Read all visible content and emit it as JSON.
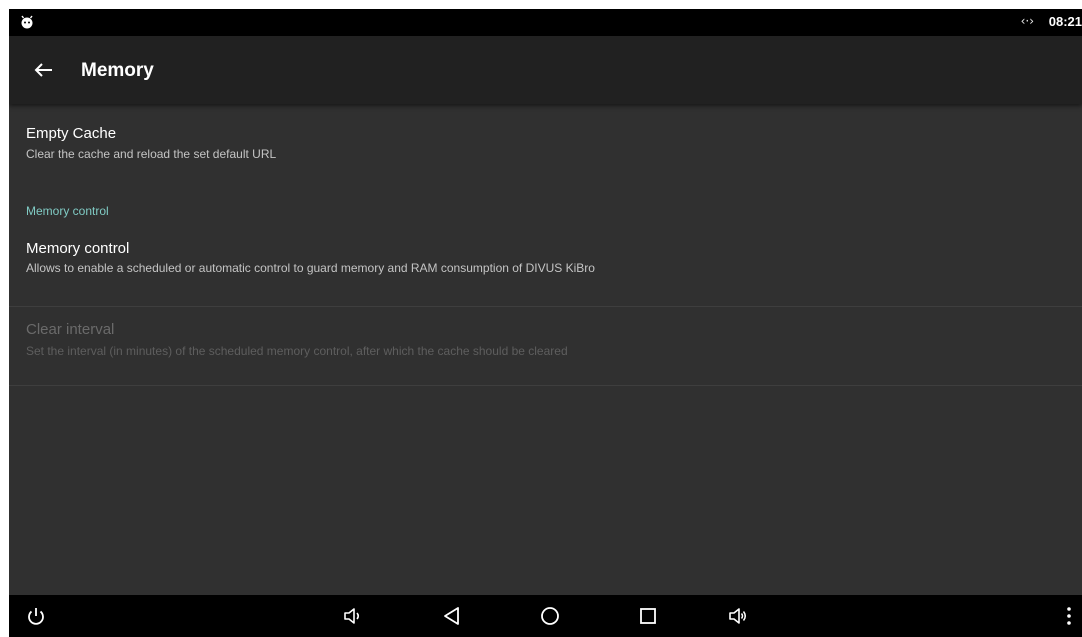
{
  "status_bar": {
    "app_icon": "android-icon",
    "signal_text": "‹·›",
    "time": "08:21"
  },
  "toolbar": {
    "back_icon": "arrow-back-icon",
    "title": "Memory"
  },
  "preferences": {
    "empty_cache": {
      "title": "Empty Cache",
      "summary": "Clear the cache and reload the set default URL"
    },
    "category": {
      "label": "Memory control"
    },
    "memory_control": {
      "title": "Memory control",
      "summary": "Allows to enable a scheduled or automatic control to guard memory and RAM consumption of DIVUS KiBro"
    },
    "clear_interval": {
      "title": "Clear interval",
      "summary": "Set the interval (in minutes) of the scheduled memory control, after which the cache should be cleared",
      "enabled": false
    }
  },
  "nav_bar": {
    "icons": [
      "power-icon",
      "volume-down-icon",
      "back-icon",
      "home-icon",
      "recents-icon",
      "volume-up-icon",
      "overflow-menu-icon"
    ]
  },
  "colors": {
    "accent": "#80cbc4",
    "toolbar": "#212121",
    "background": "#303030"
  }
}
